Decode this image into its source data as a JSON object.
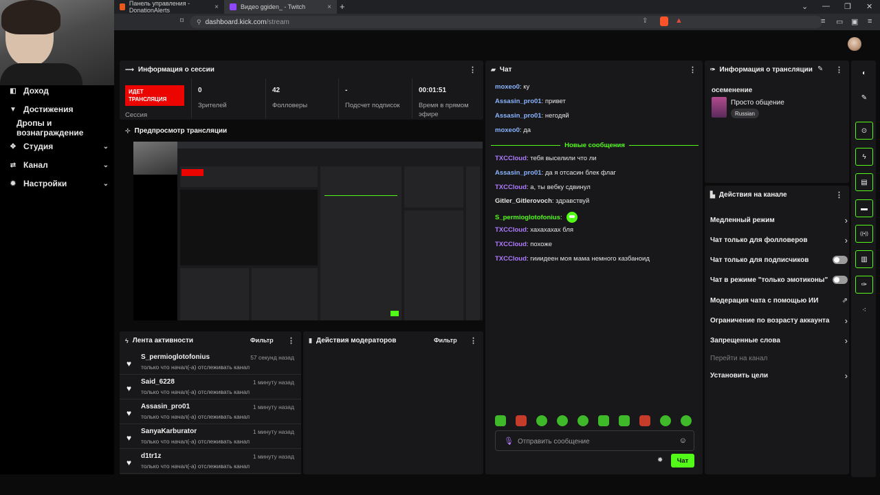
{
  "browser": {
    "tabs": [
      {
        "label": "Панель управления - DonationAlerts",
        "close": "×"
      },
      {
        "label": "Видео ggiden_ - Twitch",
        "close": "×"
      }
    ],
    "new_tab": "+",
    "url_domain": "dashboard.kick.com",
    "url_path": "/stream",
    "window_controls": [
      "⌄",
      "—",
      "❐",
      "✕"
    ]
  },
  "nav": {
    "items": [
      {
        "label": "Доход",
        "icon": "revenue-icon",
        "glyph": "◧"
      },
      {
        "label": "Достижения",
        "icon": "trophy-icon",
        "glyph": "🏆"
      },
      {
        "label": "Дропы и вознаграждение",
        "icon": "",
        "glyph": ""
      },
      {
        "label": "Студия",
        "icon": "studio-icon",
        "glyph": "✥"
      },
      {
        "label": "Канал",
        "icon": "channel-icon",
        "glyph": "⇄"
      },
      {
        "label": "Настройки",
        "icon": "gear-icon",
        "glyph": "✹"
      }
    ]
  },
  "session": {
    "title": "Информация о сессии",
    "live_badge": "ИДЕТ ТРАНСЛЯЦИЯ",
    "session_label": "Сессия",
    "stats": [
      {
        "value": "0",
        "label": "Зрителей"
      },
      {
        "value": "42",
        "label": "Фолловеры"
      },
      {
        "value": "-",
        "label": "Подсчет подписок"
      },
      {
        "value": "00:01:51",
        "label": "Время в прямом эфире"
      }
    ]
  },
  "preview": {
    "title": "Предпросмотр трансляции"
  },
  "activity": {
    "title": "Лента активности",
    "filter": "Фильтр",
    "items": [
      {
        "name": "S_permioglotofonius",
        "sub": "только что начал(-а) отслеживать канал",
        "time": "57 секунд назад"
      },
      {
        "name": "Said_6228",
        "sub": "только что начал(-а) отслеживать канал",
        "time": "1 минуту назад"
      },
      {
        "name": "Assasin_pro01",
        "sub": "только что начал(-а) отслеживать канал",
        "time": "1 минуту назад"
      },
      {
        "name": "SanyaKarburator",
        "sub": "только что начал(-а) отслеживать канал",
        "time": "1 минуту назад"
      },
      {
        "name": "d1tr1z",
        "sub": "только что начал(-а) отслеживать канал",
        "time": "1 минуту назад"
      }
    ]
  },
  "mod_actions": {
    "title": "Действия модераторов",
    "filter": "Фильтр"
  },
  "chat": {
    "title": "Чат",
    "new_messages": "Новые сообщения",
    "messages_before": [
      {
        "user": "moxeo0",
        "text": "ку",
        "color": "#8ab4ff"
      },
      {
        "user": "Assasin_pro01",
        "text": "привет",
        "color": "#8ab4ff"
      },
      {
        "user": "Assasin_pro01",
        "text": "негодяй",
        "color": "#8ab4ff"
      },
      {
        "user": "moxeo0",
        "text": "да",
        "color": "#8ab4ff"
      }
    ],
    "messages_after": [
      {
        "user": "TXCCloud",
        "text": "тебя выселили что ли",
        "color": "#b07bff"
      },
      {
        "user": "Assasin_pro01",
        "text": "да я отсасин блек флаг",
        "color": "#8ab4ff"
      },
      {
        "user": "TXCCloud",
        "text": "а, ты вебку сдвинул",
        "color": "#b07bff"
      },
      {
        "user": "Gitler_Gitlerovoch",
        "text": "здравствуй",
        "color": "#e6e6e6"
      },
      {
        "user": "S_permioglotofonius",
        "text": "",
        "color": "#53fc18",
        "emote": true
      },
      {
        "user": "TXCCloud",
        "text": "хахахахах бля",
        "color": "#b07bff"
      },
      {
        "user": "TXCCloud",
        "text": "похоже",
        "color": "#b07bff"
      },
      {
        "user": "TXCCloud",
        "text": "гииидеен моя мама немного казбаноид",
        "color": "#b07bff"
      }
    ],
    "input_placeholder": "Отправить сообщение",
    "send_label": "Чат"
  },
  "stream_info": {
    "title": "Информация о трансляции",
    "stream_title": "осеменение",
    "category": "Просто общение",
    "language": "Russian"
  },
  "channel_actions": {
    "title": "Действия на канале",
    "items": [
      {
        "label": "Медленный режим",
        "kind": "arrow"
      },
      {
        "label": "Чат только для фолловеров",
        "kind": "arrow"
      },
      {
        "label": "Чат только для подписчиков",
        "kind": "toggle"
      },
      {
        "label": "Чат в режиме \"только эмотиконы\"",
        "kind": "toggle"
      },
      {
        "label": "Модерация чата с помощью ИИ",
        "kind": "external"
      },
      {
        "label": "Ограничение по возрасту аккаунта",
        "kind": "arrow"
      },
      {
        "label": "Запрещенные слова",
        "kind": "arrow"
      },
      {
        "label": "Перейти на канал",
        "kind": "dim"
      },
      {
        "label": "Установить цели",
        "kind": "arrow"
      }
    ]
  },
  "rail": {
    "buttons": [
      {
        "name": "moon-icon",
        "glyph": "◐"
      },
      {
        "name": "pencil-icon",
        "glyph": "✎"
      },
      {
        "name": "camera-focus-icon",
        "glyph": "⊙"
      },
      {
        "name": "lightning-icon",
        "glyph": "ϟ"
      },
      {
        "name": "notes-icon",
        "glyph": "▤"
      },
      {
        "name": "chat-bubble-icon",
        "glyph": "▬"
      },
      {
        "name": "broadcast-icon",
        "glyph": "((•))"
      },
      {
        "name": "layout-icon",
        "glyph": "▥"
      },
      {
        "name": "wrench-icon",
        "glyph": "✑"
      },
      {
        "name": "nodes-icon",
        "glyph": "⁖"
      }
    ]
  },
  "colors": {
    "accent": "#53fc18",
    "live": "#eb0400",
    "panel": "#18181a",
    "background": "#0b0b0c"
  }
}
